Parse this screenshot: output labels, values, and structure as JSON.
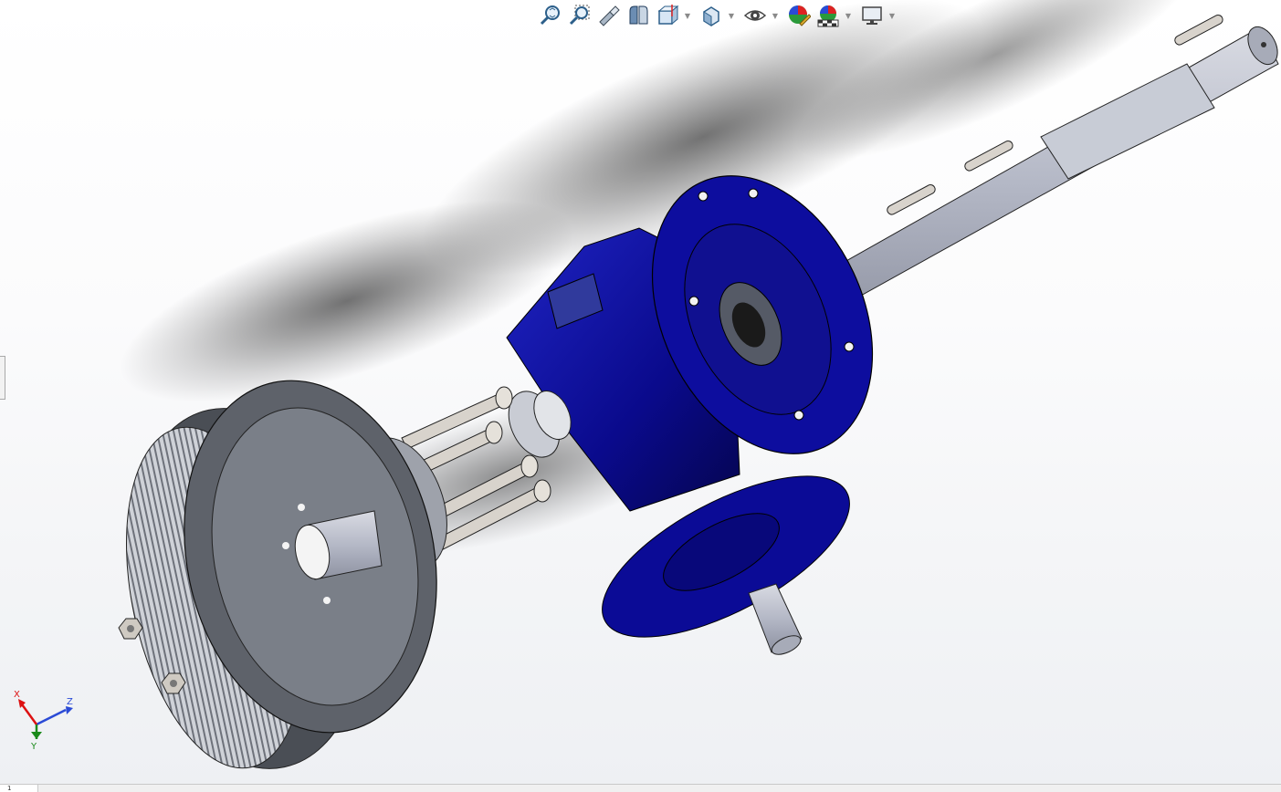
{
  "toolbar": {
    "buttons": [
      {
        "id": "zoom-to-fit",
        "icon": "zoom-to-fit-icon",
        "dropdown": false
      },
      {
        "id": "zoom-to-area",
        "icon": "zoom-to-area-icon",
        "dropdown": false
      },
      {
        "id": "previous-view",
        "icon": "previous-view-icon",
        "dropdown": false
      },
      {
        "id": "section-view",
        "icon": "section-view-icon",
        "dropdown": false
      },
      {
        "id": "view-orientation",
        "icon": "view-orientation-icon",
        "dropdown": true
      },
      {
        "id": "display-style",
        "icon": "display-style-icon",
        "dropdown": true
      },
      {
        "id": "hide-show-items",
        "icon": "eye-icon",
        "dropdown": true
      },
      {
        "id": "edit-appearance",
        "icon": "appearance-sphere-icon",
        "dropdown": false
      },
      {
        "id": "apply-scene",
        "icon": "scene-icon",
        "dropdown": true
      },
      {
        "id": "view-settings",
        "icon": "monitor-icon",
        "dropdown": true
      }
    ]
  },
  "triad": {
    "x_label": "X",
    "y_label": "Y",
    "z_label": "Z"
  },
  "status": {
    "tab_label": "1"
  },
  "colors": {
    "gearbox": "#0a0a8c",
    "shaft": "#b4b8c6",
    "pulley": "#5a5e66",
    "pulley_face": "#7a7f88",
    "hardware": "#d8d3cc",
    "axis_x": "#d11",
    "axis_y": "#1a8a1a",
    "axis_z": "#2a4bd6"
  }
}
